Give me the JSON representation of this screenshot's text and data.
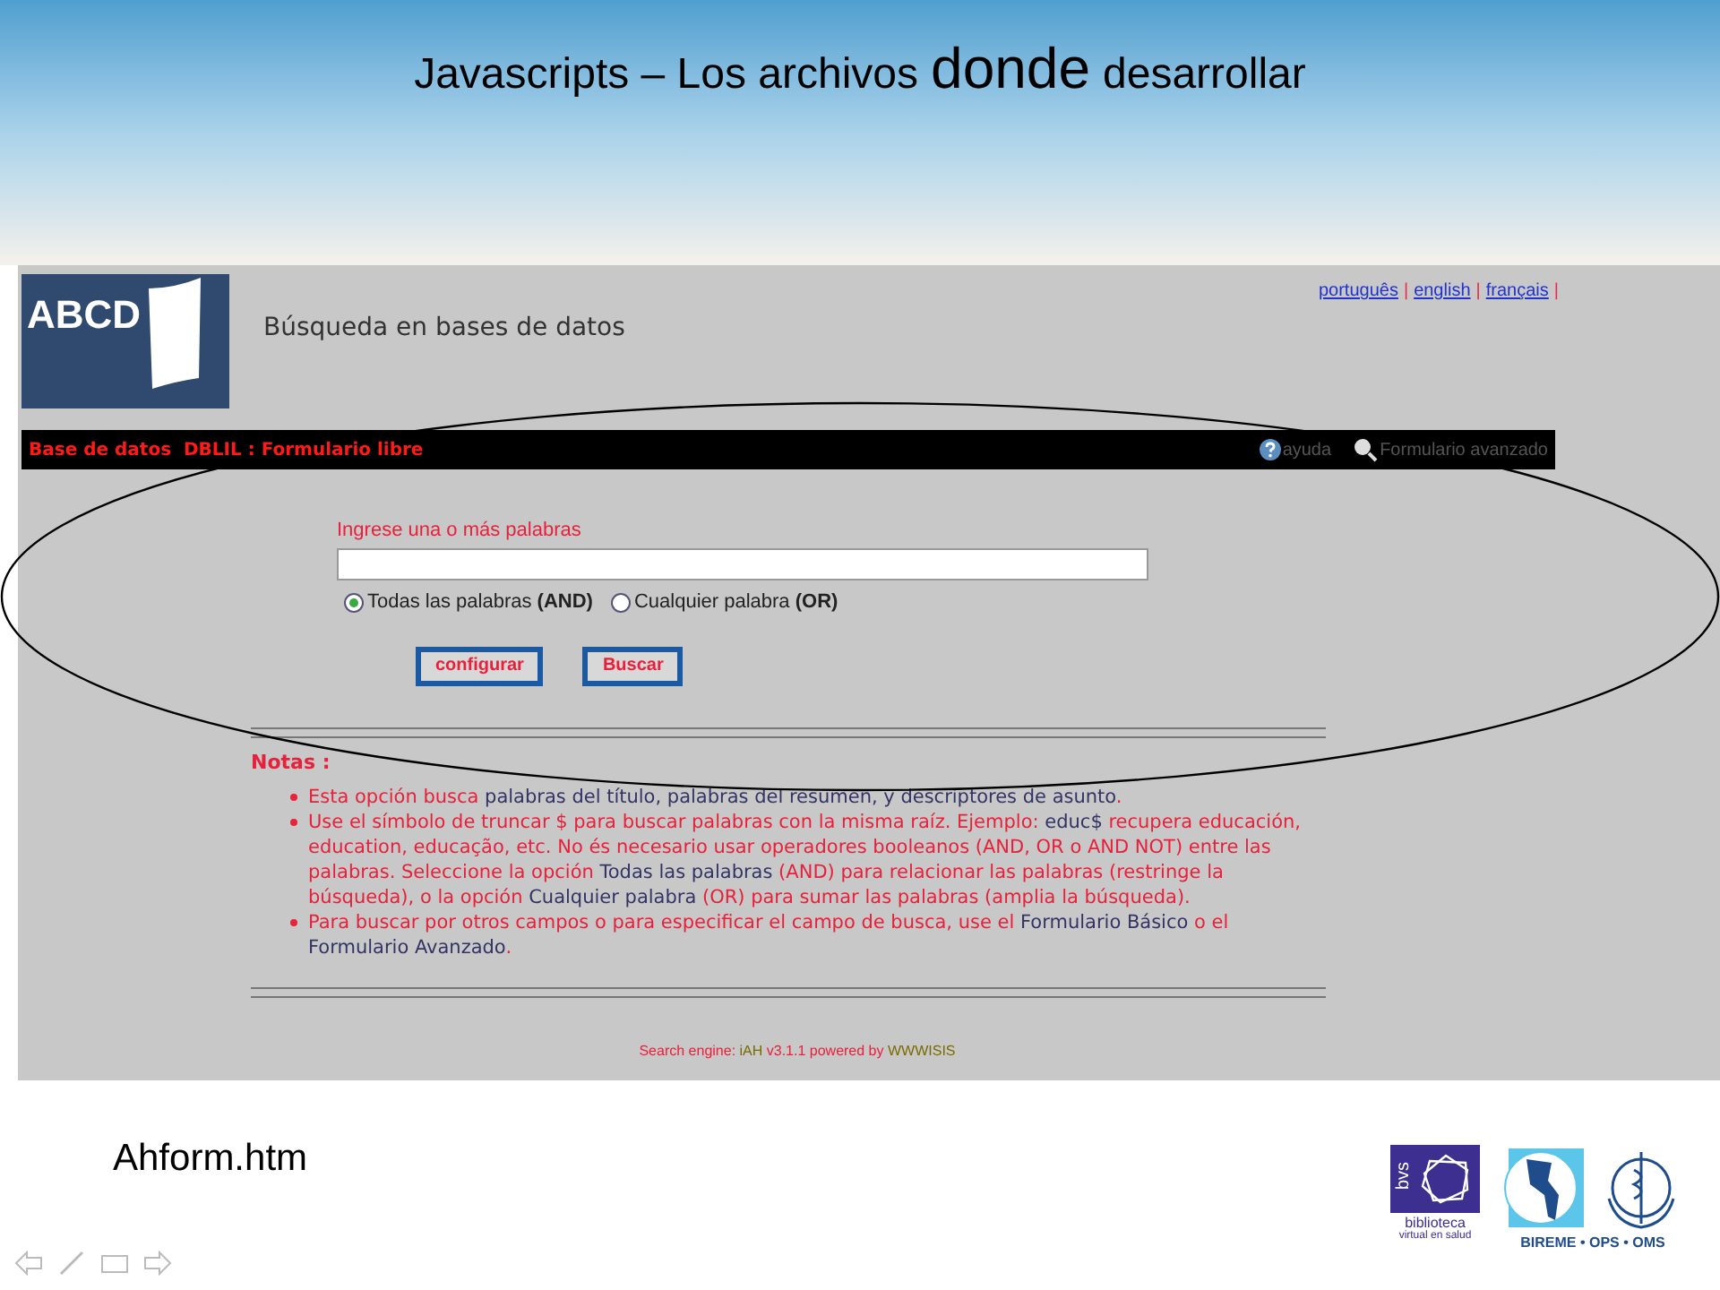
{
  "slide": {
    "title": [
      {
        "text": "Javascripts – Los archivos",
        "kind": "normal"
      },
      {
        "text": "donde",
        "kind": "large"
      },
      {
        "text": "desarrollar",
        "kind": "normal"
      }
    ],
    "caption": "Ahform.htm",
    "bvs_mark": "bvs",
    "bvs_caption": [
      "biblioteca",
      "virtual en salud"
    ],
    "partners": "BIREME • OPS • OMS"
  },
  "page": {
    "logo": "ABCD",
    "heading": "Búsqueda en bases de datos",
    "languages": [
      {
        "label": "português",
        "sep": "|"
      },
      {
        "label": "english",
        "sep": "|"
      },
      {
        "label": "français",
        "sep": "|"
      }
    ],
    "toolbar": {
      "database": "Base de datos  DBLIL : Formulario libre",
      "help": "ayuda",
      "advanced": "Formulario avanzado"
    },
    "form": {
      "label": "Ingrese una o más palabras",
      "options": [
        {
          "label": "Todas las palabras",
          "operator": "(AND)",
          "selected": true
        },
        {
          "label": "Cualquier palabra",
          "operator": "(OR)",
          "selected": false
        }
      ],
      "buttons": [
        "configurar",
        "Buscar"
      ]
    },
    "notes": {
      "heading": "Notas :",
      "items": [
        [
          {
            "text": "Esta opción busca ",
            "kind": "plain"
          },
          {
            "text": "palabras del título, palabras del resumen, y descriptores de asunto",
            "kind": "term"
          },
          {
            "text": ".",
            "kind": "plain"
          }
        ],
        [
          {
            "text": "Use el símbolo de truncar $ para buscar palabras con la misma raíz. Ejemplo: ",
            "kind": "plain"
          },
          {
            "text": "educ$",
            "kind": "term"
          },
          {
            "text": " recupera educación, education, educação, etc. No és necesario usar operadores booleanos (AND, OR o AND NOT) entre las palabras. Seleccione la opción ",
            "kind": "plain"
          },
          {
            "text": "Todas las palabras",
            "kind": "term"
          },
          {
            "text": " (AND) para relacionar las palabras (restringe la búsqueda), o la opción ",
            "kind": "plain"
          },
          {
            "text": "Cualquier palabra",
            "kind": "term"
          },
          {
            "text": " (OR) para sumar las palabras (amplia la búsqueda).",
            "kind": "plain"
          }
        ],
        [
          {
            "text": "Para buscar por otros campos o para especificar el campo de busca, use el ",
            "kind": "plain"
          },
          {
            "text": "Formulario Básico",
            "kind": "term"
          },
          {
            "text": " o el ",
            "kind": "plain"
          },
          {
            "text": "Formulario Avanzado",
            "kind": "term"
          },
          {
            "text": ".",
            "kind": "plain"
          }
        ]
      ]
    },
    "footer": [
      {
        "text": "Search engine: ",
        "kind": "plain"
      },
      {
        "text": "iAH",
        "kind": "term"
      },
      {
        "text": " v3.1.1 powered by ",
        "kind": "plain"
      },
      {
        "text": "WWWISIS",
        "kind": "term"
      }
    ]
  }
}
